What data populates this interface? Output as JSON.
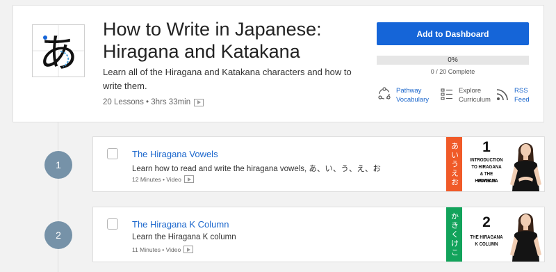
{
  "course": {
    "title_line1": "How to Write in Japanese:",
    "title_line2": "Hiragana and Katakana",
    "description": "Learn all of the Hiragana and Katakana characters and how to write them.",
    "meta": "20 Lessons • 3hrs 33min",
    "logo_char": "あ"
  },
  "actions": {
    "add_to_dashboard": "Add to Dashboard",
    "progress_percent": "0%",
    "progress_value": 0,
    "progress_count": "0 / 20 Complete"
  },
  "links": {
    "pathway_line1": "Pathway",
    "pathway_line2": "Vocabulary",
    "explore_line1": "Explore",
    "explore_line2": "Curriculum",
    "rss_line1": "RSS",
    "rss_line2": "Feed"
  },
  "lessons": [
    {
      "number": "1",
      "title": "The Hiragana Vowels",
      "description": "Learn how to read and write the hiragana vowels, あ、い、う、え、お",
      "meta": "12 Minutes • Video",
      "thumb_kana": "あいうえお",
      "thumb_number": "1",
      "thumb_caption_1": "INTRODUCTION",
      "thumb_caption_2": "TO HIRAGANA",
      "thumb_caption_3": "& THE HIRAGANA",
      "thumb_caption_4": "VOWELS",
      "thumb_color": "#f05a28"
    },
    {
      "number": "2",
      "title": "The Hiragana K Column",
      "description": "Learn the Hiragana K column",
      "meta": "11 Minutes • Video",
      "thumb_kana": "かきくけこ",
      "thumb_number": "2",
      "thumb_caption_1": "THE HIRAGANA",
      "thumb_caption_2": "K COLUMN",
      "thumb_color": "#12a35b"
    }
  ],
  "colors": {
    "accent": "#1565d8",
    "link": "#1a66cc",
    "step_circle": "#7692a8"
  }
}
